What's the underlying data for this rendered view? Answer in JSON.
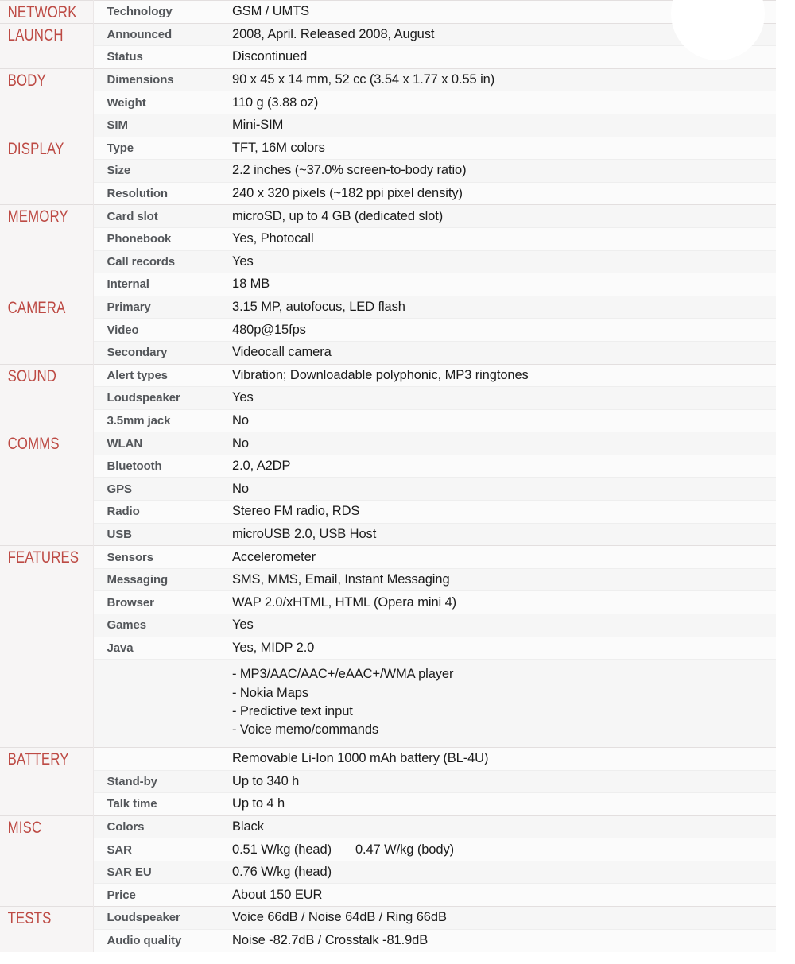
{
  "accent_color": "#bd4a44",
  "label_color": "#53565a",
  "value_color": "#1b1b1b",
  "sections": [
    {
      "category": "NETWORK",
      "rows": [
        {
          "label": "Technology",
          "value": "GSM / UMTS"
        }
      ]
    },
    {
      "category": "LAUNCH",
      "rows": [
        {
          "label": "Announced",
          "value": "2008, April. Released 2008, August"
        },
        {
          "label": "Status",
          "value": "Discontinued"
        }
      ]
    },
    {
      "category": "BODY",
      "rows": [
        {
          "label": "Dimensions",
          "value": "90 x 45 x 14 mm, 52 cc (3.54 x 1.77 x 0.55 in)"
        },
        {
          "label": "Weight",
          "value": "110 g (3.88 oz)"
        },
        {
          "label": "SIM",
          "value": "Mini-SIM"
        }
      ]
    },
    {
      "category": "DISPLAY",
      "rows": [
        {
          "label": "Type",
          "value": "TFT, 16M colors"
        },
        {
          "label": "Size",
          "value": "2.2 inches (~37.0% screen-to-body ratio)"
        },
        {
          "label": "Resolution",
          "value": "240 x 320 pixels (~182 ppi pixel density)"
        }
      ]
    },
    {
      "category": "MEMORY",
      "rows": [
        {
          "label": "Card slot",
          "value": "microSD, up to 4 GB (dedicated slot)"
        },
        {
          "label": "Phonebook",
          "value": "Yes, Photocall"
        },
        {
          "label": "Call records",
          "value": "Yes"
        },
        {
          "label": "Internal",
          "value": "18 MB"
        }
      ]
    },
    {
      "category": "CAMERA",
      "rows": [
        {
          "label": "Primary",
          "value": "3.15 MP, autofocus, LED flash"
        },
        {
          "label": "Video",
          "value": "480p@15fps"
        },
        {
          "label": "Secondary",
          "value": "Videocall camera"
        }
      ]
    },
    {
      "category": "SOUND",
      "rows": [
        {
          "label": "Alert types",
          "value": "Vibration; Downloadable polyphonic, MP3 ringtones"
        },
        {
          "label": "Loudspeaker",
          "value": "Yes"
        },
        {
          "label": "3.5mm jack",
          "value": "No"
        }
      ]
    },
    {
      "category": "COMMS",
      "rows": [
        {
          "label": "WLAN",
          "value": "No"
        },
        {
          "label": "Bluetooth",
          "value": "2.0, A2DP"
        },
        {
          "label": "GPS",
          "value": "No"
        },
        {
          "label": "Radio",
          "value": "Stereo FM radio, RDS"
        },
        {
          "label": "USB",
          "value": "microUSB 2.0, USB Host"
        }
      ]
    },
    {
      "category": "FEATURES",
      "rows": [
        {
          "label": "Sensors",
          "value": "Accelerometer"
        },
        {
          "label": "Messaging",
          "value": "SMS, MMS, Email, Instant Messaging"
        },
        {
          "label": "Browser",
          "value": "WAP 2.0/xHTML, HTML (Opera mini 4)"
        },
        {
          "label": "Games",
          "value": "Yes"
        },
        {
          "label": "Java",
          "value": "Yes, MIDP 2.0"
        },
        {
          "label": "",
          "value_lines": [
            "- MP3/AAC/AAC+/eAAC+/WMA player",
            "- Nokia Maps",
            "- Predictive text input",
            "- Voice memo/commands"
          ]
        }
      ]
    },
    {
      "category": "BATTERY",
      "rows": [
        {
          "label": "",
          "value": "Removable Li-Ion 1000 mAh battery (BL-4U)"
        },
        {
          "label": "Stand-by",
          "value": "Up to 340 h"
        },
        {
          "label": "Talk time",
          "value": "Up to 4 h"
        }
      ]
    },
    {
      "category": "MISC",
      "rows": [
        {
          "label": "Colors",
          "value": "Black"
        },
        {
          "label": "SAR",
          "value_parts": [
            "0.51 W/kg (head)",
            "0.47 W/kg (body)"
          ]
        },
        {
          "label": "SAR EU",
          "value": "0.76 W/kg (head)"
        },
        {
          "label": "Price",
          "value": "About 150 EUR"
        }
      ]
    },
    {
      "category": "TESTS",
      "rows": [
        {
          "label": "Loudspeaker",
          "value": "Voice 66dB / Noise 64dB / Ring 66dB"
        },
        {
          "label": "Audio quality",
          "value": "Noise -82.7dB / Crosstalk -81.9dB"
        }
      ]
    }
  ]
}
